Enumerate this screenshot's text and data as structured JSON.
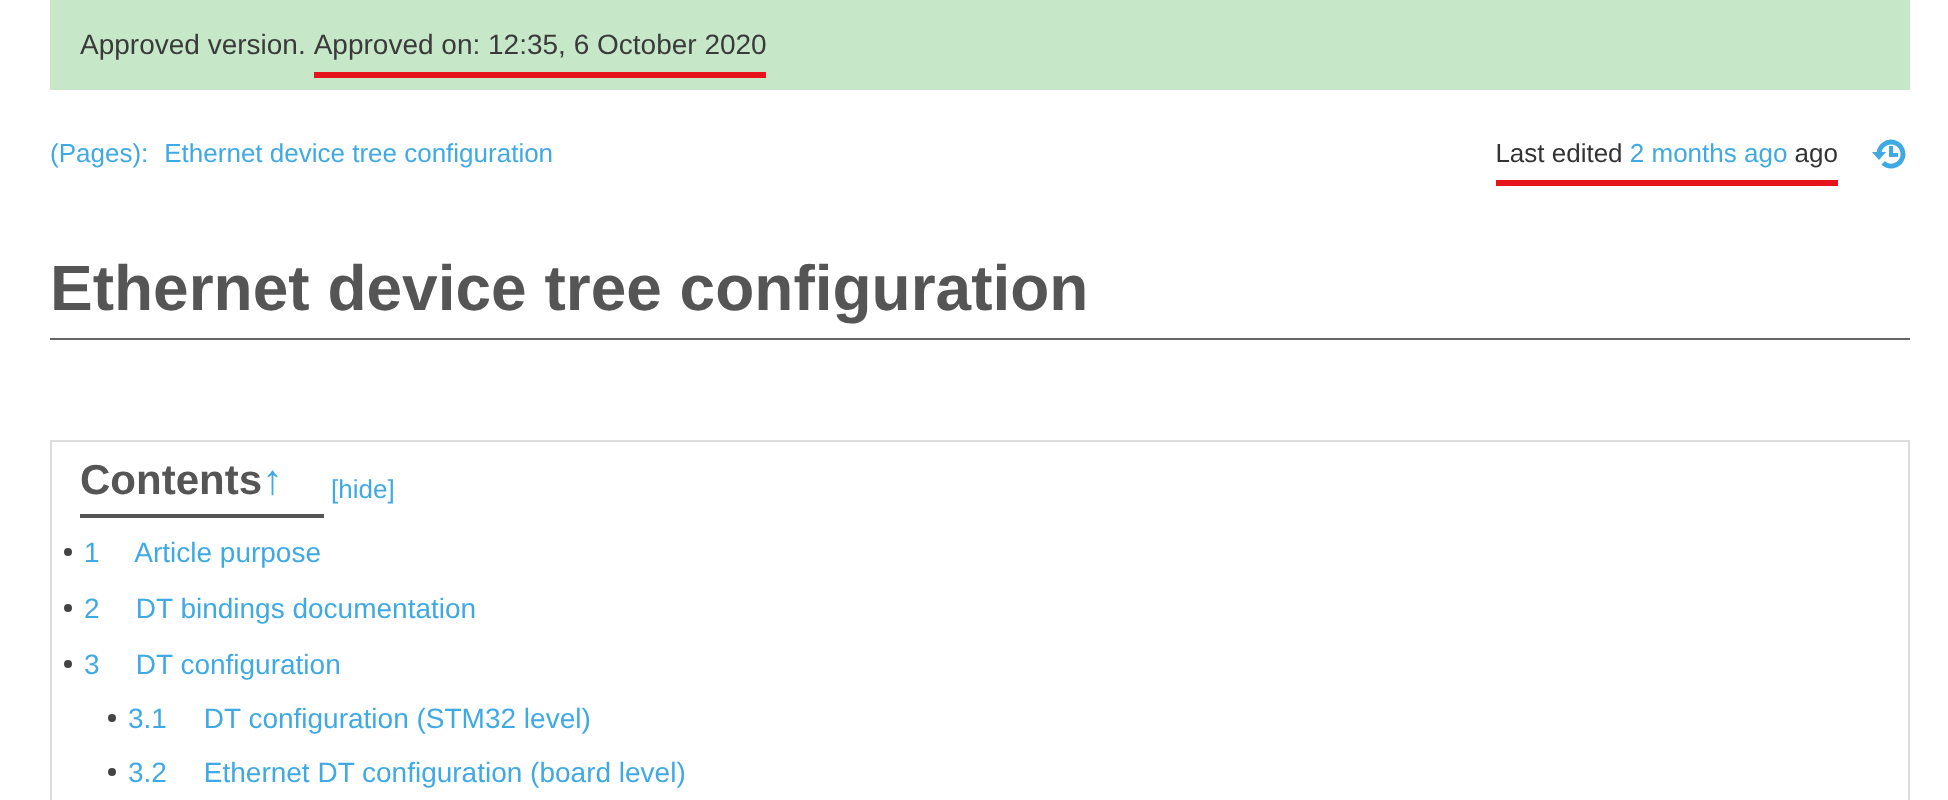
{
  "banner": {
    "status": "Approved version.",
    "approval": {
      "text": "Approved on: 12:35, 6 October 2020",
      "marked": true
    }
  },
  "breadcrumb": {
    "namespace": "(Pages):",
    "page": "Ethernet device tree configuration"
  },
  "last_edited": {
    "prefix": "Last edited",
    "link": "2 months ago",
    "suffix": "ago",
    "marked": true
  },
  "title": "Ethernet device tree configuration",
  "toc": {
    "heading": "Contents",
    "arrow": "↑",
    "toggle": "[hide]",
    "items": [
      {
        "number": "1",
        "label": "Article purpose"
      },
      {
        "number": "2",
        "label": "DT bindings documentation"
      },
      {
        "number": "3",
        "label": "DT configuration",
        "children": [
          {
            "number": "3.1",
            "label": "DT configuration (STM32 level)"
          },
          {
            "number": "3.2",
            "label": "Ethernet DT configuration (board level)"
          }
        ]
      }
    ]
  }
}
